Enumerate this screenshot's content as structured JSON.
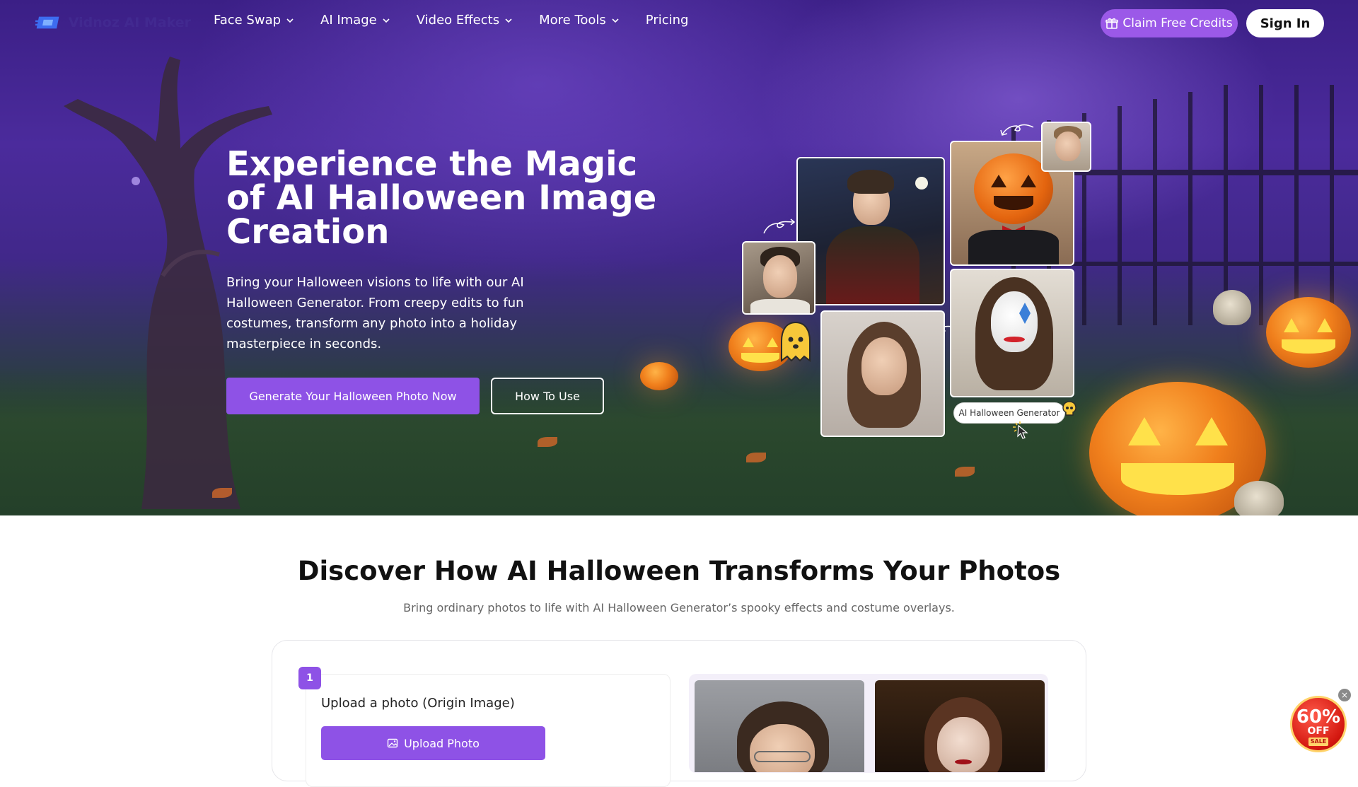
{
  "brand": {
    "name": "Vidnoz AI Maker"
  },
  "nav": {
    "items": [
      {
        "label": "Face Swap",
        "has_dropdown": true
      },
      {
        "label": "AI Image",
        "has_dropdown": true
      },
      {
        "label": "Video Effects",
        "has_dropdown": true
      },
      {
        "label": "More Tools",
        "has_dropdown": true
      },
      {
        "label": "Pricing",
        "has_dropdown": false
      }
    ],
    "claim_label": "Claim Free Credits",
    "signin_label": "Sign In"
  },
  "hero": {
    "title": "Experience the Magic of AI Halloween Image Creation",
    "subtitle": "Bring your Halloween visions to life with our AI Halloween Generator. From creepy edits to fun costumes, transform any photo into a holiday masterpiece in seconds.",
    "primary_button": "Generate Your Halloween Photo Now",
    "secondary_button": "How To Use",
    "collage_tag": "AI Halloween Generator"
  },
  "section": {
    "title": "Discover How AI Halloween Transforms Your Photos",
    "subtitle": "Bring ordinary photos to life with AI Halloween Generator’s spooky effects and costume overlays.",
    "step_number": "1",
    "step_label": "Upload a photo (Origin Image)",
    "upload_button": "Upload Photo"
  },
  "sale_badge": {
    "percent": "60%",
    "off": "OFF",
    "sale": "SALE",
    "close": "×"
  },
  "colors": {
    "accent": "#8e52e6",
    "claim": "#9b59e8",
    "badge": "#d3170f"
  },
  "icons": [
    "logo-icon",
    "chevron-down-icon",
    "gift-icon",
    "image-upload-icon",
    "ghost-icon",
    "skull-icon",
    "close-icon"
  ]
}
